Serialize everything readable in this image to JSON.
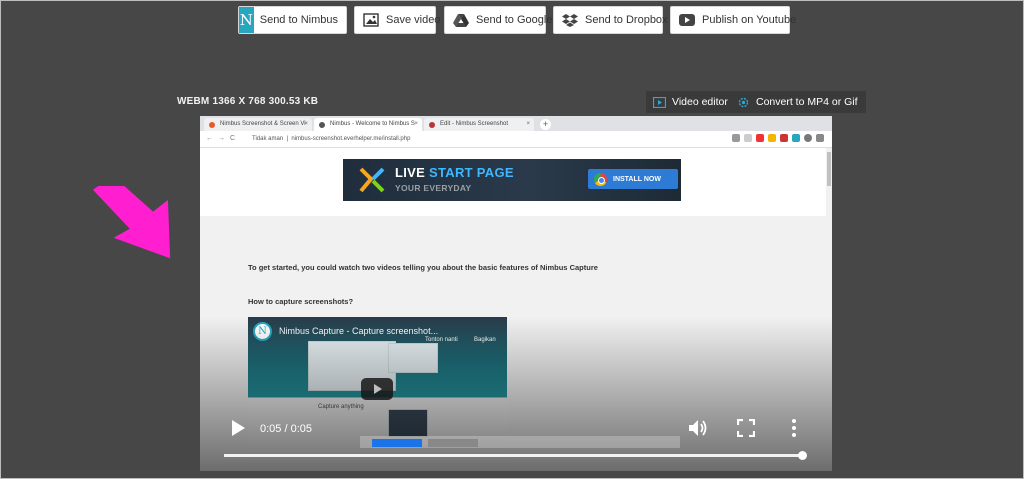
{
  "toolbar": {
    "send_nimbus": "Send to Nimbus",
    "save_video": "Save video",
    "send_google": "Send to Google",
    "send_dropbox": "Send to Dropbox",
    "publish_youtube": "Publish on Youtube"
  },
  "file_info": "WEBM 1366 X 768 300.53 KB",
  "actions": {
    "video_editor": "Video editor",
    "convert": "Convert to MP4 or Gif"
  },
  "browser": {
    "tabs": [
      {
        "label": "Nimbus Screenshot & Screen Vi"
      },
      {
        "label": "Nimbus - Welcome to Nimbus S"
      },
      {
        "label": "Edit - Nimbus Screenshot"
      }
    ],
    "secure_label": "Tidak aman",
    "url": "nimbus-screenshot.everhelper.me/install.php"
  },
  "page": {
    "banner_title_a": "LIVE ",
    "banner_title_b": "START PAGE",
    "banner_sub": "YOUR EVERYDAY",
    "banner_install": "INSTALL NOW",
    "intro_text": "To get started, you could watch two videos telling you about the basic features of Nimbus Capture",
    "howto_text": "How to capture screenshots?",
    "yt_title": "Nimbus Capture - Capture screenshot...",
    "yt_watch_later": "Tonton nanti",
    "yt_share": "Bagikan",
    "yt_caption": "Capture anything"
  },
  "player": {
    "time": "0:05 / 0:05",
    "progress": 1.0
  },
  "colors": {
    "background": "#474747",
    "nimbus_brand": "#29a6bf",
    "arrow": "#ff1fd1"
  }
}
